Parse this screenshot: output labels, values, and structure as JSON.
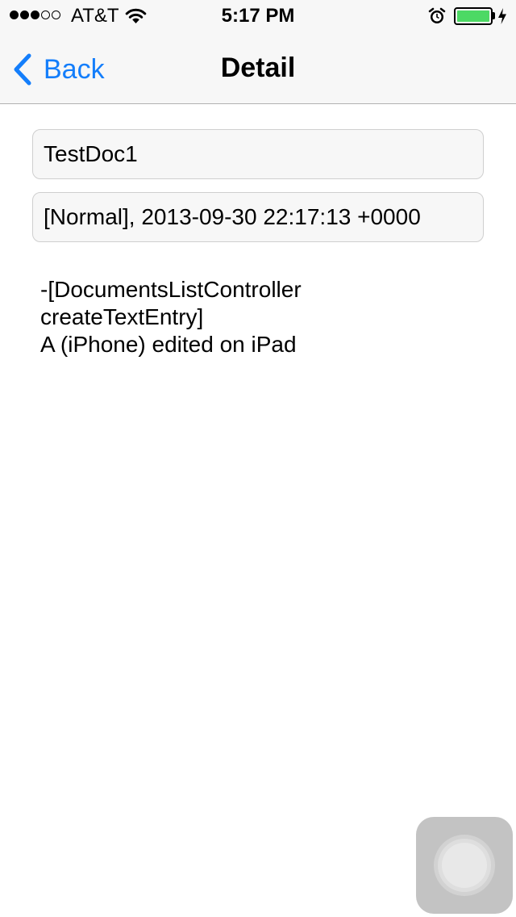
{
  "status_bar": {
    "signal_bars_filled": 3,
    "signal_bars_total": 5,
    "carrier": "AT&T",
    "time": "5:17 PM",
    "battery_level": 1.0,
    "battery_color": "#4cd964",
    "icons": [
      "wifi-icon",
      "alarm-icon",
      "battery-icon",
      "charging-bolt-icon"
    ]
  },
  "nav": {
    "back_label": "Back",
    "title": "Detail",
    "tint_color": "#147efb"
  },
  "detail": {
    "title_value": "TestDoc1",
    "status_value": "[Normal], 2013-09-30 22:17:13 +0000",
    "body_text": "-[DocumentsListController\ncreateTextEntry]\nA (iPhone) edited on iPad"
  },
  "assistive_touch": {
    "icon": "assistive-touch-icon"
  }
}
